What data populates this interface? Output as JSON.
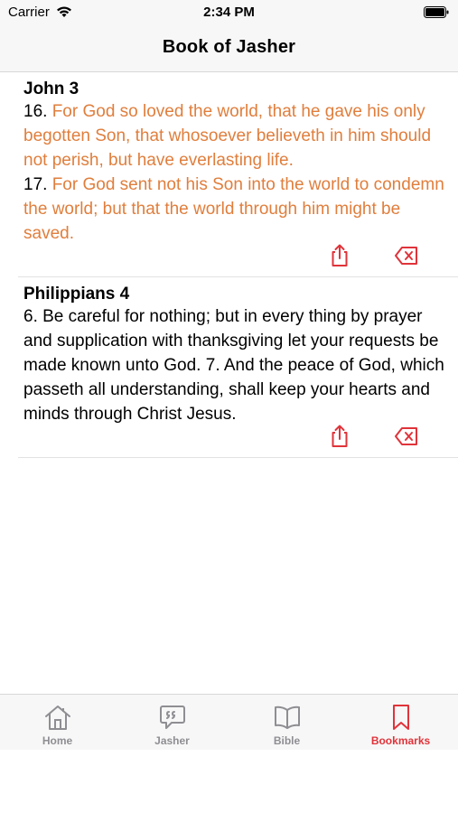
{
  "status_bar": {
    "carrier": "Carrier",
    "time": "2:34 PM"
  },
  "nav": {
    "title": "Book of Jasher"
  },
  "bookmarks": [
    {
      "reference": "John 3",
      "style": "orange",
      "verses": [
        {
          "number": "16.",
          "text": " For God so loved the world, that he gave his only begotten Son, that whosoever believeth in him should not perish, but have everlasting life."
        },
        {
          "number": "17.",
          "text": " For God sent not his Son into the world to condemn the world; but that the world through him might be saved."
        }
      ]
    },
    {
      "reference": "Philippians 4",
      "style": "black",
      "verses": [
        {
          "number": "6.",
          "text": " Be careful for nothing; but in every thing by prayer and supplication with thanksgiving let your requests be made known unto God."
        },
        {
          "number": " 7.",
          "text": " And the peace of God, which passeth all understanding, shall keep your hearts and minds through Christ Jesus."
        }
      ]
    }
  ],
  "tabs": [
    {
      "label": "Home",
      "icon": "house-icon",
      "active": false
    },
    {
      "label": "Jasher",
      "icon": "quote-bubble-icon",
      "active": false
    },
    {
      "label": "Bible",
      "icon": "book-icon",
      "active": false
    },
    {
      "label": "Bookmarks",
      "icon": "bookmark-icon",
      "active": true
    }
  ],
  "colors": {
    "verse_highlight": "#e07e3c",
    "accent": "#e0333a",
    "inactive_tab": "#8e8e93"
  }
}
